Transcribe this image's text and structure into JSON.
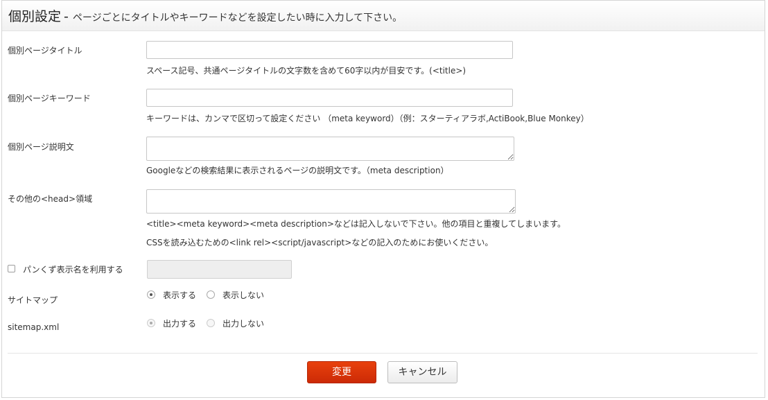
{
  "header": {
    "title": "個別設定",
    "separator": "-",
    "description": "ページごとにタイトルやキーワードなどを設定したい時に入力して下さい。"
  },
  "fields": {
    "page_title": {
      "label": "個別ページタイトル",
      "value": "",
      "help": "スペース記号、共通ページタイトルの文字数を含めて60字以内が目安です。(<title>)"
    },
    "page_keywords": {
      "label": "個別ページキーワード",
      "value": "",
      "help": "キーワードは、カンマで区切って設定ください （meta keyword）（例：スターティアラボ,ActiBook,Blue Monkey）"
    },
    "page_description": {
      "label": "個別ページ説明文",
      "value": "",
      "help": "Googleなどの検索結果に表示されるページの説明文です。（meta description）"
    },
    "head_area": {
      "label": "その他の<head>領域",
      "value": "",
      "help_line1": "<title><meta keyword><meta description>などは記入しないで下さい。他の項目と重複してしまいます。",
      "help_line2": "CSSを読み込むための<link rel><script/javascript>などの記入のためにお使いください。"
    },
    "breadcrumb": {
      "label": "パンくず表示名を利用する",
      "checked": false,
      "value": ""
    },
    "sitemap": {
      "label": "サイトマップ",
      "options": [
        "表示する",
        "表示しない"
      ],
      "selected": "表示する"
    },
    "sitemap_xml": {
      "label": "sitemap.xml",
      "options": [
        "出力する",
        "出力しない"
      ],
      "selected": "出力する",
      "disabled": true
    }
  },
  "buttons": {
    "submit": "変更",
    "cancel": "キャンセル"
  },
  "colors": {
    "primary_button": "#d9340a",
    "panel_border": "#d4d4d4"
  }
}
